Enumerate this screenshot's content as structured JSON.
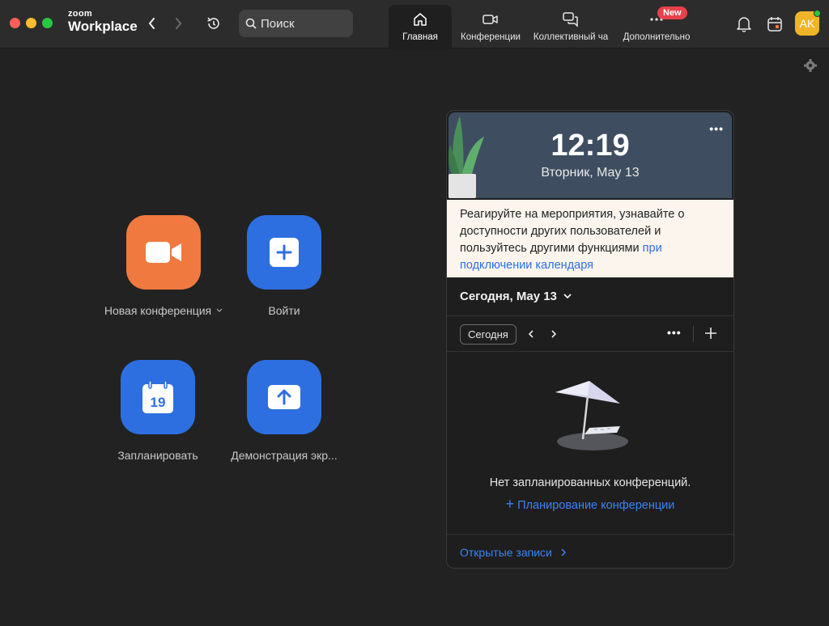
{
  "app": {
    "logo_top": "zoom",
    "logo_bottom": "Workplace"
  },
  "search": {
    "placeholder": "Поиск"
  },
  "tabs": [
    {
      "label": "Главная",
      "icon": "home-icon"
    },
    {
      "label": "Конференции",
      "icon": "video-icon"
    },
    {
      "label": "Коллективный ча",
      "icon": "chat-icon"
    },
    {
      "label": "Дополнительно",
      "icon": "more-icon"
    }
  ],
  "badge_new": "New",
  "avatar_initials": "AK",
  "actions": [
    {
      "label": "Новая конференция",
      "icon": "video-camera-icon",
      "color": "#f0793f"
    },
    {
      "label": "Войти",
      "icon": "plus-icon",
      "color": "#2d6fe0"
    },
    {
      "label": "Запланировать",
      "icon": "calendar-icon",
      "calendar_day": "19",
      "color": "#2d6fe0"
    },
    {
      "label": "Демонстрация экр...",
      "icon": "share-up-arrow-icon",
      "color": "#2d6fe0"
    }
  ],
  "calendar": {
    "time": "12:19",
    "date": "Вторник, May 13",
    "more": "•••",
    "notice_text": "Реагируйте на мероприятия, узнавайте о доступности других пользователей и пользуйтесь другими функциями ",
    "notice_link": "при подключении календаря",
    "today_header": "Сегодня, May 13",
    "today_button": "Сегодня",
    "empty_text": "Нет запланированных конференций.",
    "plan_link": "Планирование конференции",
    "open_records": "Открытые записи"
  },
  "colors": {
    "accent_blue": "#2d6fe0",
    "accent_orange": "#f0793f",
    "badge_red": "#e8414a",
    "avatar_yellow": "#f0b429",
    "online_green": "#29c53f"
  }
}
